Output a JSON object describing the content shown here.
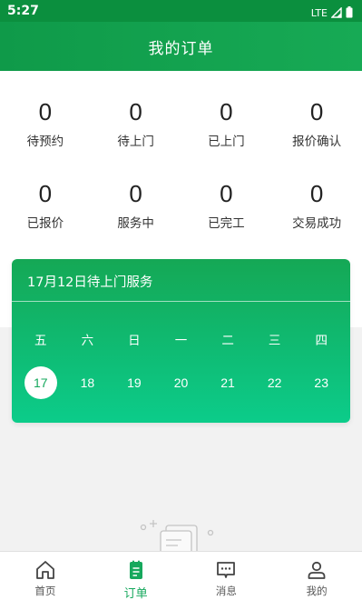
{
  "status_bar": {
    "time": "5:27",
    "network": "LTE"
  },
  "header": {
    "title": "我的订单"
  },
  "order_stats": [
    {
      "count": "0",
      "label": "待预约"
    },
    {
      "count": "0",
      "label": "待上门"
    },
    {
      "count": "0",
      "label": "已上门"
    },
    {
      "count": "0",
      "label": "报价确认"
    },
    {
      "count": "0",
      "label": "已报价"
    },
    {
      "count": "0",
      "label": "服务中"
    },
    {
      "count": "0",
      "label": "已完工"
    },
    {
      "count": "0",
      "label": "交易成功"
    }
  ],
  "calendar": {
    "title": "17月12日待上门服务",
    "weekdays": [
      "五",
      "六",
      "日",
      "一",
      "二",
      "三",
      "四"
    ],
    "dates": [
      "17",
      "18",
      "19",
      "20",
      "21",
      "22",
      "23"
    ],
    "selected_date": "17"
  },
  "bottom_nav": [
    {
      "label": "首页",
      "icon": "home-icon",
      "active": false
    },
    {
      "label": "订单",
      "icon": "order-icon",
      "active": true
    },
    {
      "label": "消息",
      "icon": "message-icon",
      "active": false
    },
    {
      "label": "我的",
      "icon": "profile-icon",
      "active": false
    }
  ],
  "colors": {
    "primary": "#16a85d",
    "header_bg": "#0f9a49",
    "status_bar_bg": "#0b8f3e"
  }
}
